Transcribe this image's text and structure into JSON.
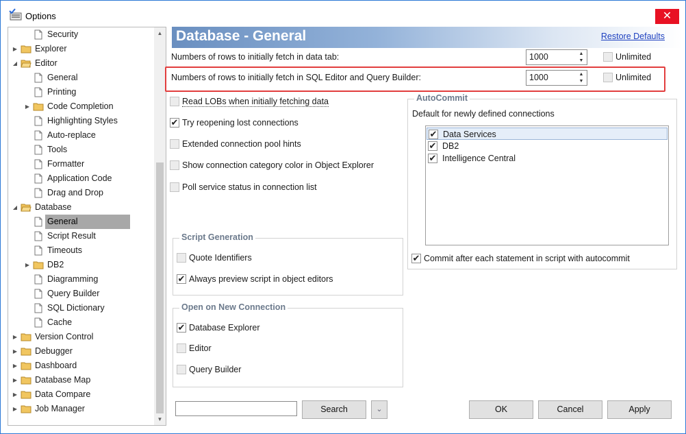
{
  "window": {
    "title": "Options",
    "close_glyph": "✕"
  },
  "tree": {
    "items": [
      {
        "label": "Security",
        "level": 2,
        "type": "page"
      },
      {
        "label": "Explorer",
        "level": 1,
        "type": "folder",
        "expander": "collapsed"
      },
      {
        "label": "Editor",
        "level": 1,
        "type": "folder-open",
        "expander": "expanded"
      },
      {
        "label": "General",
        "level": 2,
        "type": "page"
      },
      {
        "label": "Printing",
        "level": 2,
        "type": "page"
      },
      {
        "label": "Code Completion",
        "level": 2,
        "type": "folder",
        "expander": "collapsed"
      },
      {
        "label": "Highlighting Styles",
        "level": 2,
        "type": "page"
      },
      {
        "label": "Auto-replace",
        "level": 2,
        "type": "page"
      },
      {
        "label": "Tools",
        "level": 2,
        "type": "page"
      },
      {
        "label": "Formatter",
        "level": 2,
        "type": "page"
      },
      {
        "label": "Application Code",
        "level": 2,
        "type": "page"
      },
      {
        "label": "Drag and Drop",
        "level": 2,
        "type": "page"
      },
      {
        "label": "Database",
        "level": 1,
        "type": "folder-open",
        "expander": "expanded"
      },
      {
        "label": "General",
        "level": 2,
        "type": "page",
        "selected": true
      },
      {
        "label": "Script Result",
        "level": 2,
        "type": "page"
      },
      {
        "label": "Timeouts",
        "level": 2,
        "type": "page"
      },
      {
        "label": "DB2",
        "level": 2,
        "type": "folder",
        "expander": "collapsed"
      },
      {
        "label": "Diagramming",
        "level": 2,
        "type": "page"
      },
      {
        "label": "Query Builder",
        "level": 2,
        "type": "page"
      },
      {
        "label": "SQL Dictionary",
        "level": 2,
        "type": "page"
      },
      {
        "label": "Cache",
        "level": 2,
        "type": "page"
      },
      {
        "label": "Version Control",
        "level": 1,
        "type": "folder",
        "expander": "collapsed"
      },
      {
        "label": "Debugger",
        "level": 1,
        "type": "folder",
        "expander": "collapsed"
      },
      {
        "label": "Dashboard",
        "level": 1,
        "type": "folder",
        "expander": "collapsed"
      },
      {
        "label": "Database Map",
        "level": 1,
        "type": "folder",
        "expander": "collapsed"
      },
      {
        "label": "Data Compare",
        "level": 1,
        "type": "folder",
        "expander": "collapsed"
      },
      {
        "label": "Job Manager",
        "level": 1,
        "type": "folder",
        "expander": "collapsed"
      }
    ]
  },
  "header": {
    "title": "Database - General",
    "restore_label": "Restore Defaults"
  },
  "fetch": {
    "rows_data_tab_label": "Numbers of rows to initially fetch in data tab:",
    "rows_data_tab_value": "1000",
    "rows_sql_editor_label": "Numbers of rows to initially fetch in SQL Editor and Query Builder:",
    "rows_sql_editor_value": "1000",
    "unlimited_label": "Unlimited",
    "unlimited_1_checked": false,
    "unlimited_2_checked": false
  },
  "options": [
    {
      "label": "Read LOBs when initially fetching data",
      "checked": false
    },
    {
      "label": "Try reopening lost connections",
      "checked": true
    },
    {
      "label": "Extended connection pool hints",
      "checked": false
    },
    {
      "label": "Show connection category color in Object Explorer",
      "checked": false
    },
    {
      "label": "Poll service status in connection list",
      "checked": false
    }
  ],
  "script_generation": {
    "title": "Script Generation",
    "items": [
      {
        "label": "Quote Identifiers",
        "checked": false
      },
      {
        "label": "Always preview script in object editors",
        "checked": true
      }
    ]
  },
  "open_on_new_connection": {
    "title": "Open on New Connection",
    "items": [
      {
        "label": "Database Explorer",
        "checked": true
      },
      {
        "label": "Editor",
        "checked": false
      },
      {
        "label": "Query Builder",
        "checked": false
      }
    ]
  },
  "autocommit": {
    "title": "AutoCommit",
    "subtitle": "Default for newly defined connections",
    "connections": [
      {
        "label": "Data Services",
        "checked": true,
        "selected": true
      },
      {
        "label": "DB2",
        "checked": true
      },
      {
        "label": "Intelligence Central",
        "checked": true
      }
    ],
    "commit_label": "Commit after each statement in script with autocommit",
    "commit_checked": true
  },
  "footer": {
    "search_value": "",
    "search_label": "Search",
    "expand_glyph": "⌄",
    "ok_label": "OK",
    "cancel_label": "Cancel",
    "apply_label": "Apply"
  },
  "colors": {
    "accent": "#2b78d6",
    "highlight": "#e23d3d",
    "banner_start": "#6a8fc0",
    "close": "#e81123"
  }
}
